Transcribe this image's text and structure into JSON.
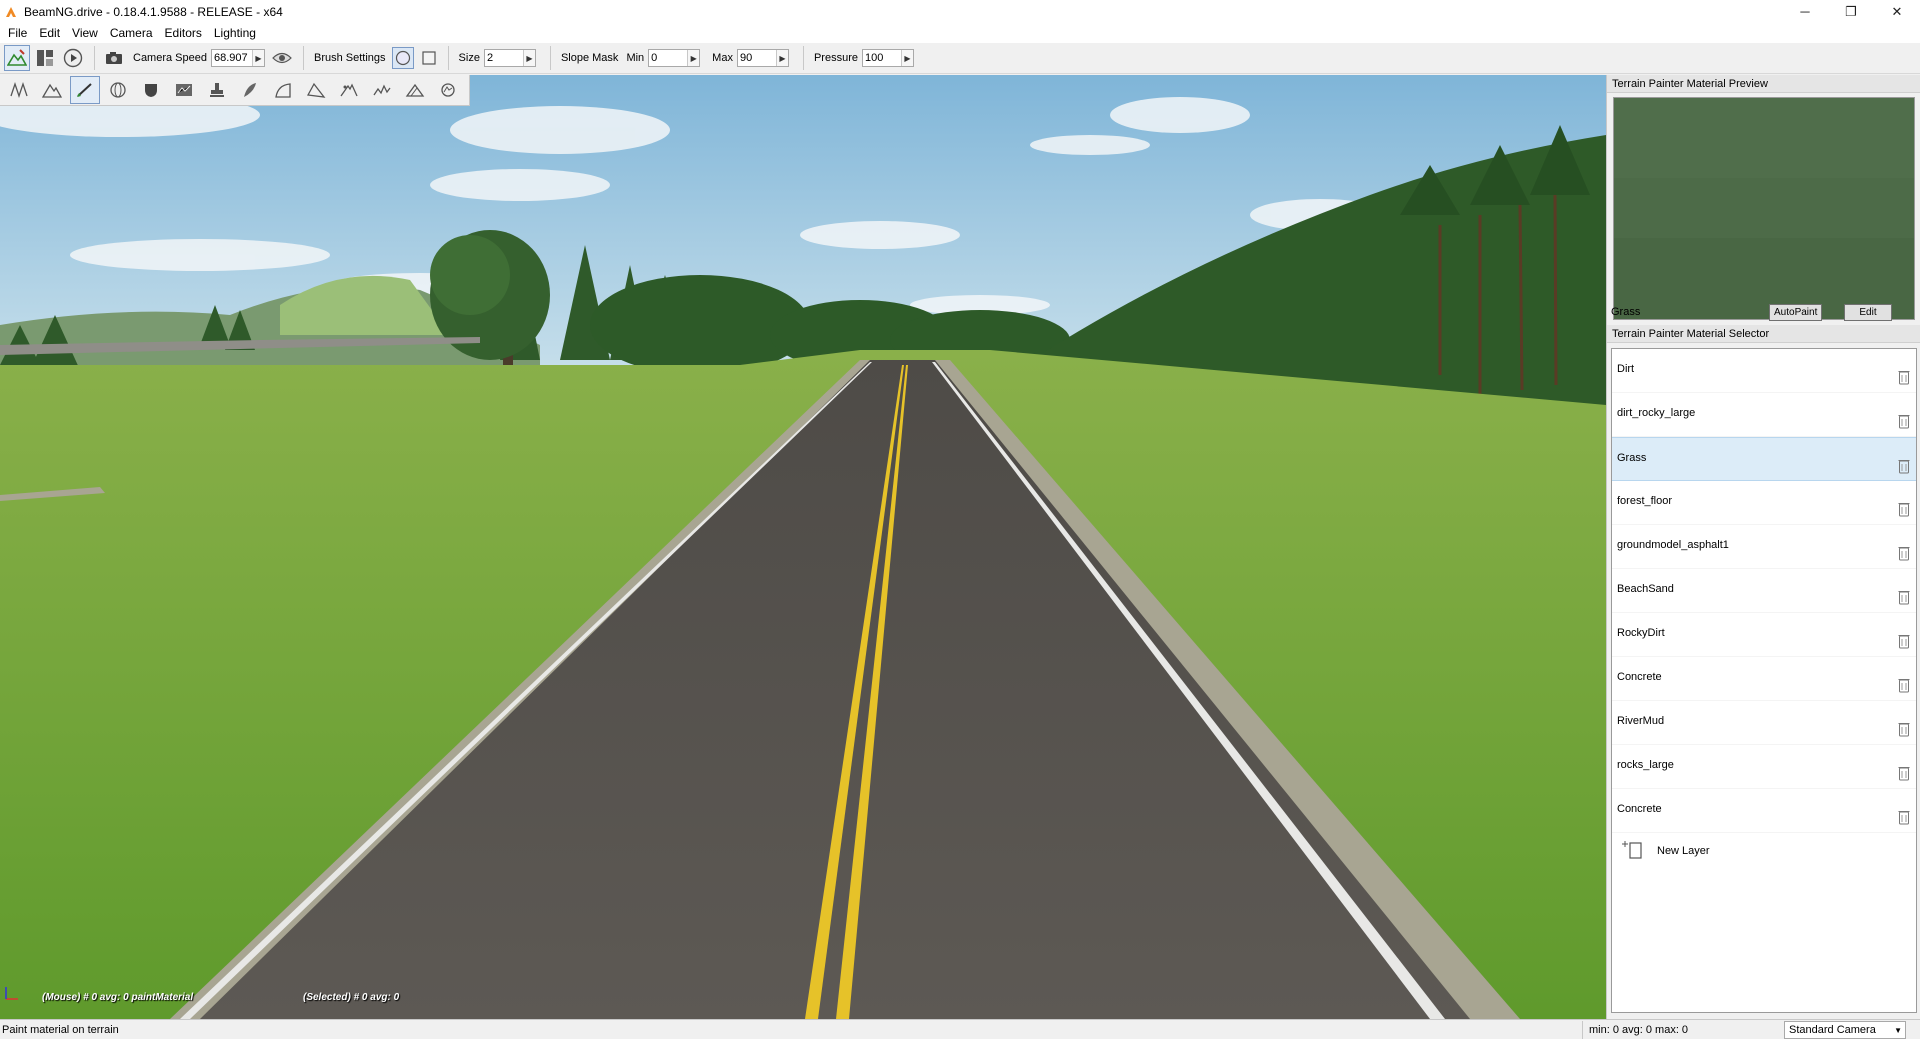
{
  "window": {
    "title": "BeamNG.drive - 0.18.4.1.9588 - RELEASE - x64",
    "controls": {
      "minimize": "─",
      "restore": "❐",
      "close": "✕"
    }
  },
  "menu": [
    "File",
    "Edit",
    "View",
    "Camera",
    "Editors",
    "Lighting"
  ],
  "toolbar": {
    "camera_speed_label": "Camera Speed",
    "camera_speed_value": "68.907",
    "brush_settings_label": "Brush Settings",
    "size_label": "Size",
    "size_value": "2",
    "slope_mask_label": "Slope Mask",
    "min_label": "Min",
    "min_value": "0",
    "max_label": "Max",
    "max_value": "90",
    "pressure_label": "Pressure",
    "pressure_value": "100"
  },
  "viewport": {
    "mouse_info": "(Mouse) # 0  avg: 0 paintMaterial",
    "selected_info": "(Selected) # 0  avg: 0"
  },
  "preview_panel": {
    "title": "Terrain Painter Material Preview",
    "material_name": "Grass",
    "autopaint_label": "AutoPaint",
    "edit_label": "Edit"
  },
  "selector_panel": {
    "title": "Terrain Painter Material Selector",
    "materials": [
      "Dirt",
      "dirt_rocky_large",
      "Grass",
      "forest_floor",
      "groundmodel_asphalt1",
      "BeachSand",
      "RockyDirt",
      "Concrete",
      "RiverMud",
      "rocks_large",
      "Concrete"
    ],
    "selected_index": 2,
    "new_layer_label": "New Layer"
  },
  "statusbar": {
    "text": "Paint material on terrain",
    "stats": "min: 0  avg: 0  max: 0",
    "camera_mode": "Standard Camera"
  },
  "colors": {
    "selected_row": "#dcecf8",
    "active_tool_border": "#7a9ac6",
    "preview_grass": "#4d6b48"
  }
}
